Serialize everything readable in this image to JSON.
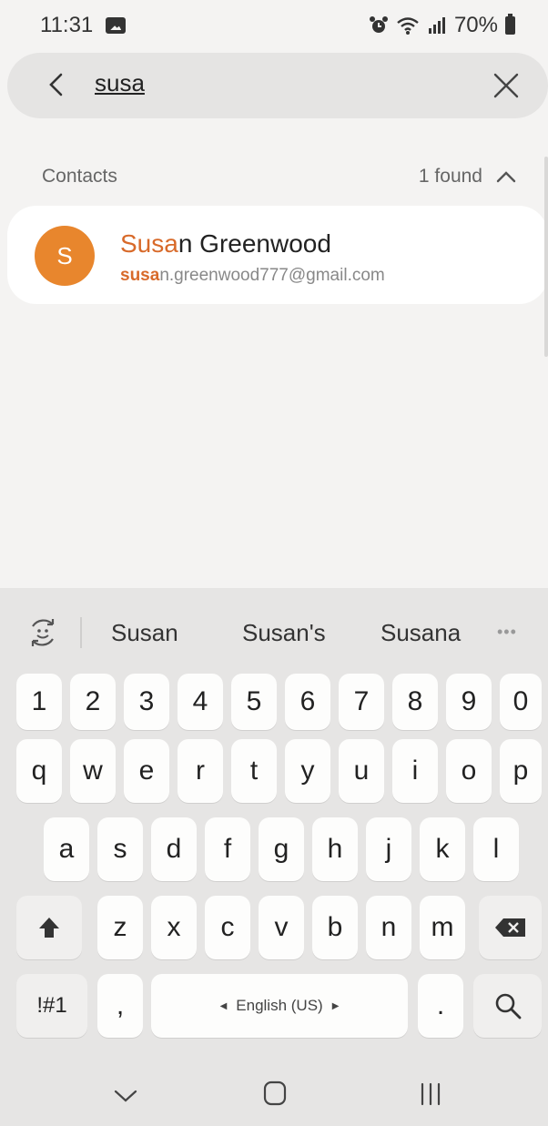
{
  "status_bar": {
    "time": "11:31",
    "battery": "70%",
    "icons": [
      "gallery-icon",
      "alarm-icon",
      "wifi-icon",
      "signal-icon",
      "battery-icon"
    ]
  },
  "search": {
    "query": "susa",
    "icons": [
      "back-icon",
      "clear-icon"
    ]
  },
  "contacts_section": {
    "title": "Contacts",
    "count_label": "1 found",
    "toggle_icon": "chevron-up-icon"
  },
  "results": [
    {
      "avatar_letter": "S",
      "avatar_color": "#e8862d",
      "name_match": "Susa",
      "name_rest": "n Greenwood",
      "email_match": "susa",
      "email_rest": "n.greenwood777@gmail.com"
    }
  ],
  "keyboard": {
    "suggestions": [
      "Susan",
      "Susan's",
      "Susana"
    ],
    "more_icon": "more-icon",
    "number_row": [
      "1",
      "2",
      "3",
      "4",
      "5",
      "6",
      "7",
      "8",
      "9",
      "0"
    ],
    "row1": [
      "q",
      "w",
      "e",
      "r",
      "t",
      "y",
      "u",
      "i",
      "o",
      "p"
    ],
    "row2": [
      "a",
      "s",
      "d",
      "f",
      "g",
      "h",
      "j",
      "k",
      "l"
    ],
    "row3": [
      "z",
      "x",
      "c",
      "v",
      "b",
      "n",
      "m"
    ],
    "symbols_label": "!#1",
    "comma_label": ",",
    "space_label": "English (US)",
    "period_label": ".",
    "icons": [
      "sticker-icon",
      "shift-icon",
      "backspace-icon",
      "search-icon"
    ]
  },
  "nav_bar": {
    "icons": [
      "nav-back-icon",
      "nav-home-icon",
      "nav-recents-icon"
    ]
  },
  "colors": {
    "highlight": "#d86a2a",
    "avatar": "#e8862d",
    "background": "#f4f3f2",
    "keyboard_bg": "#e6e5e4"
  }
}
